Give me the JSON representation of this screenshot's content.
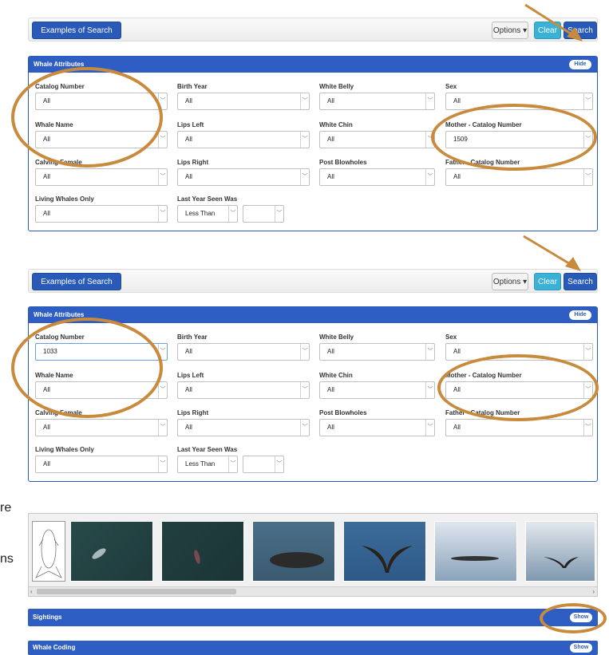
{
  "toolbar": {
    "examples_label": "Examples of Search Criteria",
    "options_label": "Options ▾",
    "clear_label": "Clear",
    "search_label": "Search"
  },
  "panel": {
    "title": "Whale Attributes",
    "hide_label": "Hide"
  },
  "labels": {
    "catalog": "Catalog Number",
    "birth_year": "Birth Year",
    "white_belly": "White Belly",
    "sex": "Sex",
    "whale_name": "Whale Name",
    "lips_left": "Lips Left",
    "white_chin": "White Chin",
    "mother": "Mother - Catalog Number",
    "calving_female": "Calving Female",
    "lips_right": "Lips Right",
    "post_blowholes": "Post Blowholes",
    "father": "Father - Catalog Number",
    "living": "Living Whales Only",
    "last_year": "Last Year Seen Was"
  },
  "form1": {
    "catalog": "All",
    "birth_year": "All",
    "white_belly": "All",
    "sex": "All",
    "whale_name": "All",
    "lips_left": "All",
    "white_chin": "All",
    "mother": "1509",
    "calving_female": "All",
    "lips_right": "All",
    "post_blowholes": "All",
    "father": "All",
    "living": "All",
    "last_op": "Less Than",
    "last_year": ""
  },
  "form2": {
    "catalog": "1033",
    "birth_year": "All",
    "white_belly": "All",
    "sex": "All",
    "whale_name": "All",
    "lips_left": "All",
    "white_chin": "All",
    "mother": "All",
    "calving_female": "All",
    "lips_right": "All",
    "post_blowholes": "All",
    "father": "All",
    "living": "All",
    "last_op": "Less Than",
    "last_year": ""
  },
  "side_text": {
    "line1": "re",
    "line2": "ns"
  },
  "scroll": {
    "left": "‹",
    "right": "›"
  },
  "sections": {
    "sightings": "Sightings",
    "coding": "Whale Coding",
    "show_label": "Show"
  },
  "colors": {
    "brand_blue": "#2e5ec4",
    "annotation": "#c88a3c",
    "clear": "#3ab2d6"
  }
}
